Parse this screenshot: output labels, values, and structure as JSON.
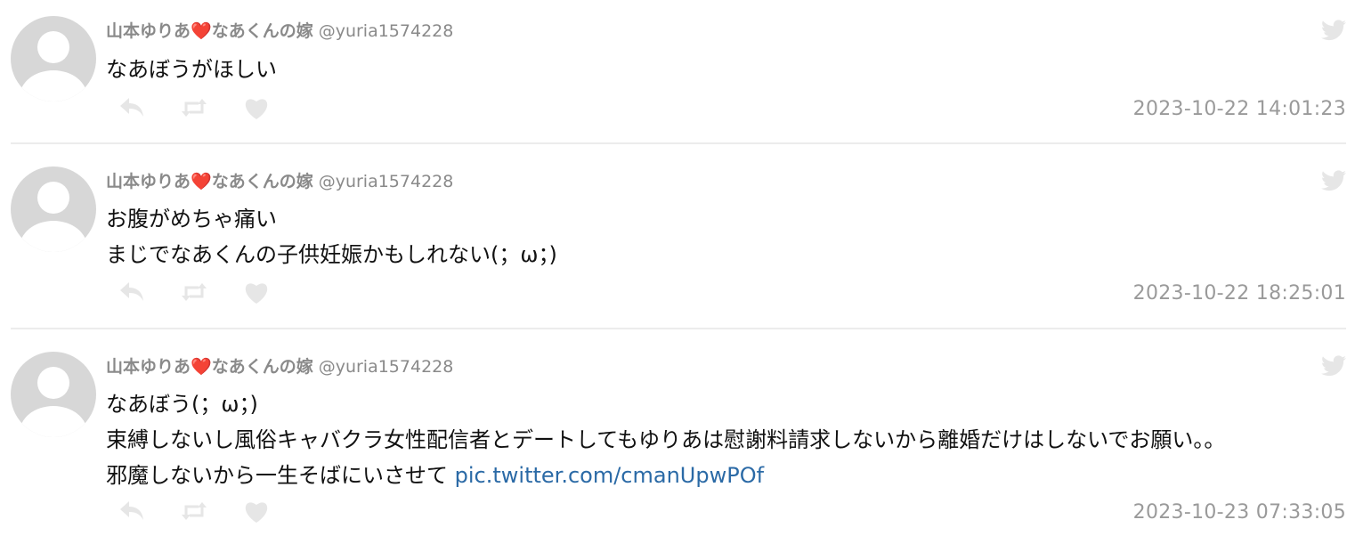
{
  "tweets": [
    {
      "display_name_prefix": "山本ゆりあ",
      "heart": "❤️",
      "display_name_suffix": "なあくんの嫁",
      "handle": "@yuria1574228",
      "lines": [
        "なあぼうがほしい"
      ],
      "link": "",
      "timestamp": "2023-10-22 14:01:23"
    },
    {
      "display_name_prefix": "山本ゆりあ",
      "heart": "❤️",
      "display_name_suffix": "なあくんの嫁",
      "handle": "@yuria1574228",
      "lines": [
        "お腹がめちゃ痛い",
        "まじでなあくんの子供妊娠かもしれない(；ω；)"
      ],
      "link": "",
      "timestamp": "2023-10-22 18:25:01"
    },
    {
      "display_name_prefix": "山本ゆりあ",
      "heart": "❤️",
      "display_name_suffix": "なあくんの嫁",
      "handle": "@yuria1574228",
      "lines": [
        "なあぼう(；ω；)",
        "束縛しないし風俗キャバクラ女性配信者とデートしてもゆりあは慰謝料請求しないから離婚だけはしないでお願い。。",
        "邪魔しないから一生そばにいさせて "
      ],
      "link": "pic.twitter.com/cmanUpwPOf",
      "timestamp": "2023-10-23 07:33:05"
    }
  ],
  "icons": {
    "reply": "reply-icon",
    "retweet": "retweet-icon",
    "like": "heart-icon",
    "brand": "twitter-bird-icon"
  },
  "colors": {
    "name": "#8a8a8a",
    "text": "#111111",
    "link": "#2b6aa6",
    "icon": "#e6e6e6",
    "divider": "#ececec"
  }
}
